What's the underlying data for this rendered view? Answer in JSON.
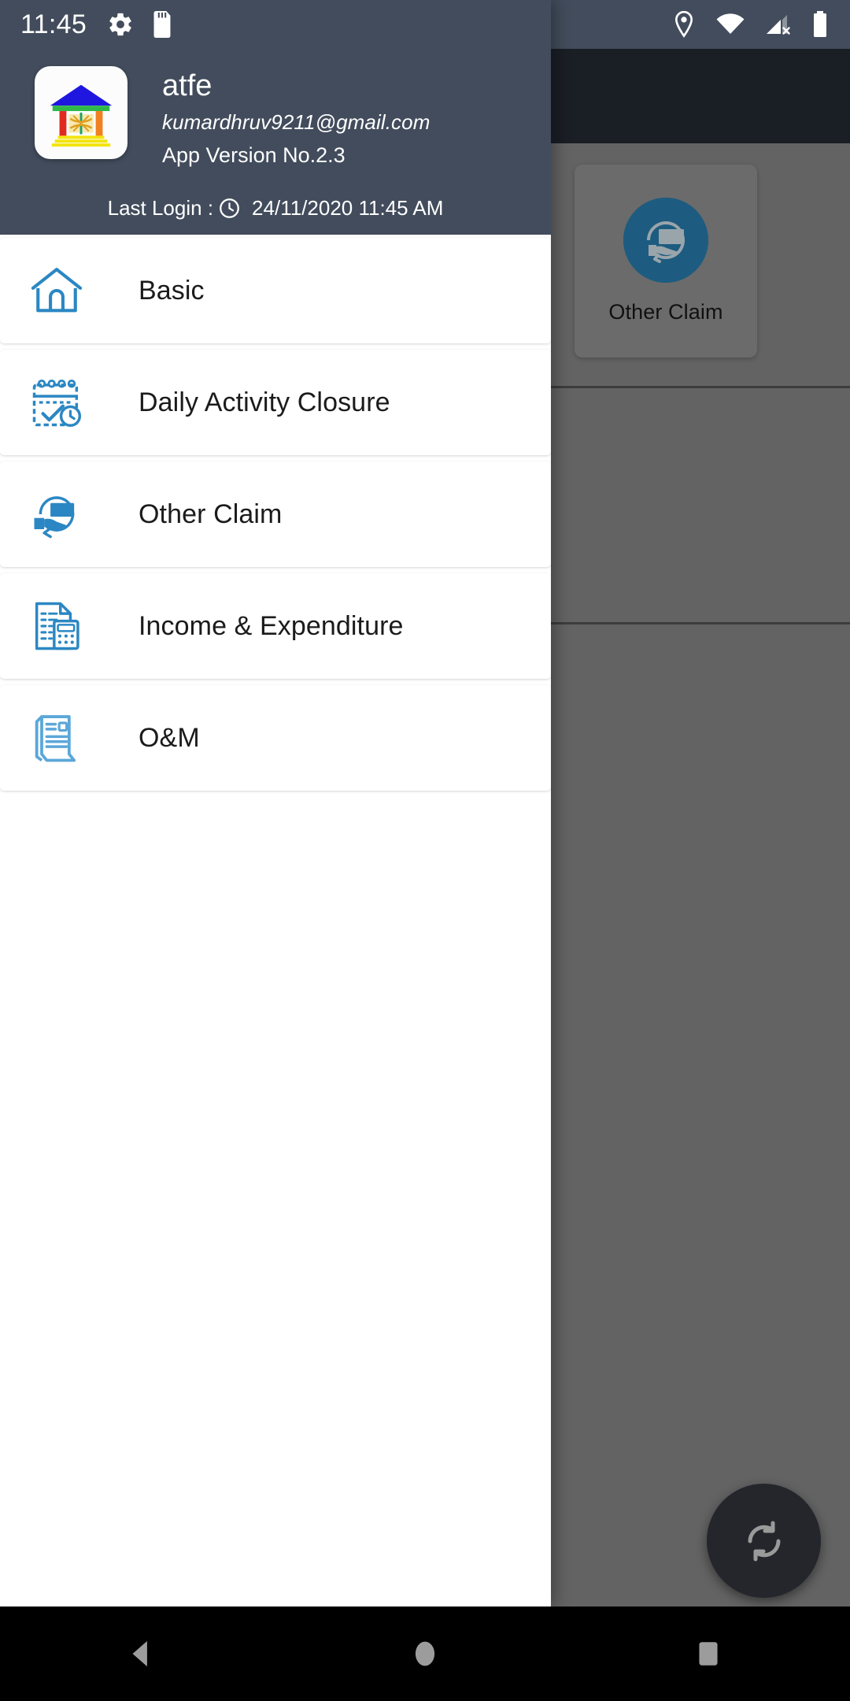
{
  "status_bar": {
    "clock": "11:45",
    "left_icons": [
      "gear-icon",
      "sd-card-icon"
    ],
    "right_icons": [
      "location-pin-icon",
      "wifi-icon",
      "cellular-signal-off-icon",
      "battery-icon"
    ],
    "background_color": "#424c5c"
  },
  "drawer": {
    "header": {
      "app_logo": "institution-logo",
      "name": "atfe",
      "email": "kumardhruv9211@gmail.com",
      "version": "App Version No.2.3",
      "last_login_label": "Last Login :",
      "last_login_icon": "clock-icon",
      "last_login_value": "24/11/2020 11:45 AM",
      "background_color": "#424c5c"
    },
    "menu_items": [
      {
        "label": "Basic",
        "icon": "home-icon"
      },
      {
        "label": "Daily Activity Closure",
        "icon": "calendar-check-clock-icon"
      },
      {
        "label": "Other Claim",
        "icon": "hand-card-refund-icon"
      },
      {
        "label": "Income & Expenditure",
        "icon": "document-calculator-icon"
      },
      {
        "label": "O&M",
        "icon": "document-scroll-icon"
      }
    ],
    "accent_color": "#2b87c3"
  },
  "background_app": {
    "toolbar_color": "#1a1e25",
    "scrim_color": "#636363",
    "tiles": [
      {
        "label": "Other Claim",
        "icon": "hand-card-refund-circle-icon",
        "icon_color": "#1d5c80"
      }
    ],
    "fab": {
      "icon": "sync-refresh-icon",
      "color": "#24262b"
    }
  },
  "nav_bar": {
    "buttons": [
      {
        "name": "back-button",
        "icon": "back-triangle-icon"
      },
      {
        "name": "home-button",
        "icon": "home-circle-icon"
      },
      {
        "name": "recents-button",
        "icon": "recents-square-icon"
      }
    ],
    "background_color": "#000000"
  }
}
